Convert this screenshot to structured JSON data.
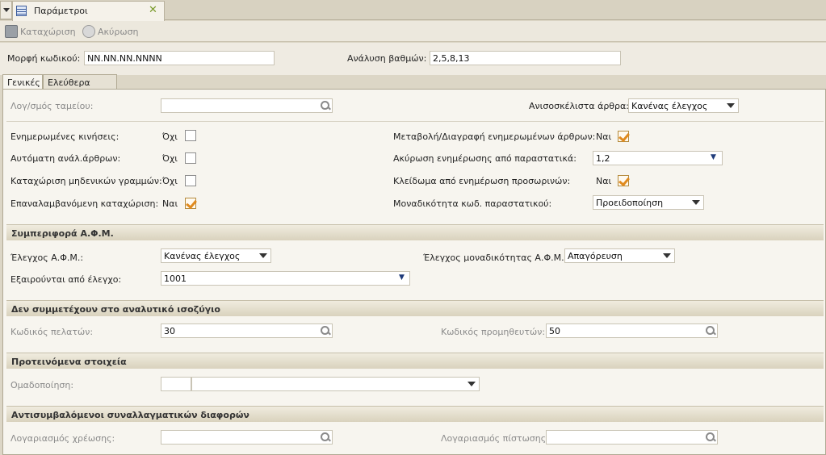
{
  "tab": {
    "title": "Παράμετροι"
  },
  "toolbar": {
    "save_label": "Καταχώριση",
    "cancel_label": "Ακύρωση"
  },
  "header": {
    "code_format_label": "Μορφή κωδικού:",
    "code_format_value": "NN.NN.NN.NNNN",
    "grade_label": "Ανάλυση βαθμών:",
    "grade_value": "2,5,8,13"
  },
  "inner_tabs": {
    "general": "Γενικές",
    "free_fields": "Ελεύθερα πεδία"
  },
  "general": {
    "cash_account_label": "Λογ/σμός ταμείου:",
    "unbalanced_label": "Ανισοσκέλιστα άρθρα:",
    "unbalanced_value": "Κανένας έλεγχος",
    "updated_moves_label": "Ενημερωμένες κινήσεις:",
    "updated_moves_value": "Όχι",
    "auto_analysis_label": "Αυτόματη ανάλ.άρθρων:",
    "auto_analysis_value": "Όχι",
    "zero_lines_label": "Καταχώριση μηδενικών γραμμών:",
    "zero_lines_value": "Όχι",
    "repeat_entry_label": "Επαναλαμβανόμενη καταχώριση:",
    "repeat_entry_value": "Ναι",
    "modify_delete_label": "Μεταβολή/Διαγραφή ενημερωμένων άρθρων:",
    "modify_delete_value": "Ναι",
    "cancel_update_label": "Ακύρωση ενημέρωσης από παραστατικά:",
    "cancel_update_value": "1,2",
    "lock_temp_label": "Κλείδωμα από ενημέρωση προσωρινών:",
    "lock_temp_value": "Ναι",
    "uniqueness_label": "Μοναδικότητα κωδ. παραστατικού:",
    "uniqueness_value": "Προειδοποίηση"
  },
  "afm": {
    "section_title": "Συμπεριφορά Α.Φ.Μ.",
    "check_label": "Έλεγχος Α.Φ.Μ.:",
    "check_value": "Κανένας έλεγχος",
    "unique_check_label": "Έλεγχος μοναδικότητας Α.Φ.Μ.:",
    "unique_check_value": "Απαγόρευση",
    "excluded_label": "Εξαιρούνται από έλεγχο:",
    "excluded_value": "1001"
  },
  "trial_balance": {
    "section_title": "Δεν συμμετέχουν στο αναλυτικό ισοζύγιο",
    "customers_label": "Κωδικός πελατών:",
    "customers_value": "30",
    "suppliers_label": "Κωδικός προμηθευτών:",
    "suppliers_value": "50"
  },
  "suggested": {
    "section_title": "Προτεινόμενα στοιχεία",
    "grouping_label": "Ομαδοποίηση:"
  },
  "fx": {
    "section_title": "Αντισυμβαλόμενοι συναλλαγματικών διαφορών",
    "debit_label": "Λογαριασμός χρέωσης:",
    "credit_label": "Λογαριασμός πίστωσης:"
  }
}
